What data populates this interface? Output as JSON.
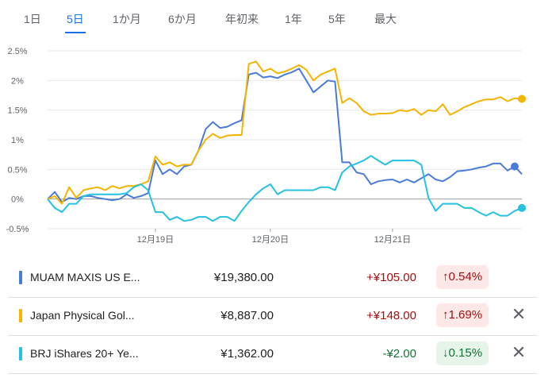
{
  "tabs": [
    "1日",
    "5日",
    "1か月",
    "6か月",
    "年初来",
    "1年",
    "5年",
    "最大"
  ],
  "active_tab": "5日",
  "chart_data": {
    "type": "line",
    "y_ticks": [
      "2.5%",
      "2%",
      "1.5%",
      "1%",
      "0.5%",
      "0%",
      "-0.5%"
    ],
    "x_ticks": [
      "12月19日",
      "12月20日",
      "12月21日"
    ],
    "ylim": [
      -0.5,
      2.5
    ],
    "grid": true,
    "series": [
      {
        "name": "MUAM MAXIS US E...",
        "color": "#4a7bd9",
        "values": [
          0.0,
          0.12,
          -0.05,
          0.02,
          0.0,
          0.05,
          0.05,
          0.02,
          0.0,
          -0.02,
          0.0,
          0.08,
          0.02,
          0.05,
          0.1,
          0.65,
          0.42,
          0.5,
          0.42,
          0.55,
          0.58,
          0.82,
          1.18,
          1.3,
          1.2,
          1.22,
          1.28,
          1.33,
          2.1,
          2.13,
          2.05,
          2.07,
          2.04,
          2.1,
          2.14,
          2.2,
          2.0,
          1.8,
          1.9,
          2.0,
          1.98,
          0.62,
          0.62,
          0.45,
          0.42,
          0.25,
          0.3,
          0.32,
          0.33,
          0.28,
          0.33,
          0.28,
          0.35,
          0.42,
          0.33,
          0.3,
          0.37,
          0.47,
          0.48,
          0.5,
          0.53,
          0.55,
          0.6,
          0.6,
          0.48,
          0.55,
          0.42
        ]
      },
      {
        "name": "Japan Physical Gol...",
        "color": "#f4b400",
        "values": [
          0.0,
          0.05,
          -0.08,
          0.2,
          0.02,
          0.15,
          0.18,
          0.2,
          0.15,
          0.22,
          0.18,
          0.22,
          0.22,
          0.25,
          0.3,
          0.72,
          0.58,
          0.62,
          0.55,
          0.58,
          0.58,
          0.82,
          1.0,
          1.1,
          1.03,
          1.07,
          1.08,
          1.08,
          2.28,
          2.32,
          2.15,
          2.2,
          2.12,
          2.15,
          2.2,
          2.26,
          2.18,
          2.0,
          2.1,
          2.15,
          2.2,
          1.62,
          1.7,
          1.62,
          1.48,
          1.42,
          1.44,
          1.44,
          1.45,
          1.5,
          1.48,
          1.52,
          1.42,
          1.5,
          1.48,
          1.6,
          1.42,
          1.48,
          1.55,
          1.6,
          1.65,
          1.68,
          1.68,
          1.72,
          1.65,
          1.7,
          1.69
        ]
      },
      {
        "name": "BRJ iShares 20+ Ye...",
        "color": "#24c1e0",
        "values": [
          0.0,
          -0.15,
          -0.22,
          -0.08,
          -0.08,
          0.05,
          0.08,
          0.08,
          0.08,
          0.08,
          0.08,
          0.1,
          0.2,
          0.25,
          0.15,
          -0.22,
          -0.22,
          -0.35,
          -0.3,
          -0.37,
          -0.35,
          -0.3,
          -0.3,
          -0.37,
          -0.3,
          -0.3,
          -0.37,
          -0.2,
          -0.05,
          0.08,
          0.18,
          0.25,
          0.08,
          0.15,
          0.15,
          0.15,
          0.15,
          0.15,
          0.2,
          0.2,
          0.15,
          0.45,
          0.55,
          0.6,
          0.65,
          0.73,
          0.65,
          0.58,
          0.65,
          0.65,
          0.65,
          0.65,
          0.58,
          0.02,
          -0.2,
          -0.08,
          -0.08,
          -0.08,
          -0.15,
          -0.15,
          -0.22,
          -0.28,
          -0.22,
          -0.28,
          -0.28,
          -0.2,
          -0.15
        ]
      }
    ]
  },
  "rows": [
    {
      "name": "MUAM MAXIS US E...",
      "price": "¥19,380.00",
      "change": "+¥105.00",
      "pct": "↑0.54%",
      "color": "#4a7bd9",
      "direction": "up"
    },
    {
      "name": "Japan Physical Gol...",
      "price": "¥8,887.00",
      "change": "+¥148.00",
      "pct": "↑1.69%",
      "color": "#f4b400",
      "direction": "up"
    },
    {
      "name": "BRJ iShares 20+ Ye...",
      "price": "¥1,362.00",
      "change": "-¥2.00",
      "pct": "↓0.15%",
      "color": "#24c1e0",
      "direction": "down"
    }
  ],
  "colors": {
    "up": "#a50e0e",
    "down": "#137333",
    "accent": "#1a73e8",
    "zero_line": "#9e9e9e"
  }
}
